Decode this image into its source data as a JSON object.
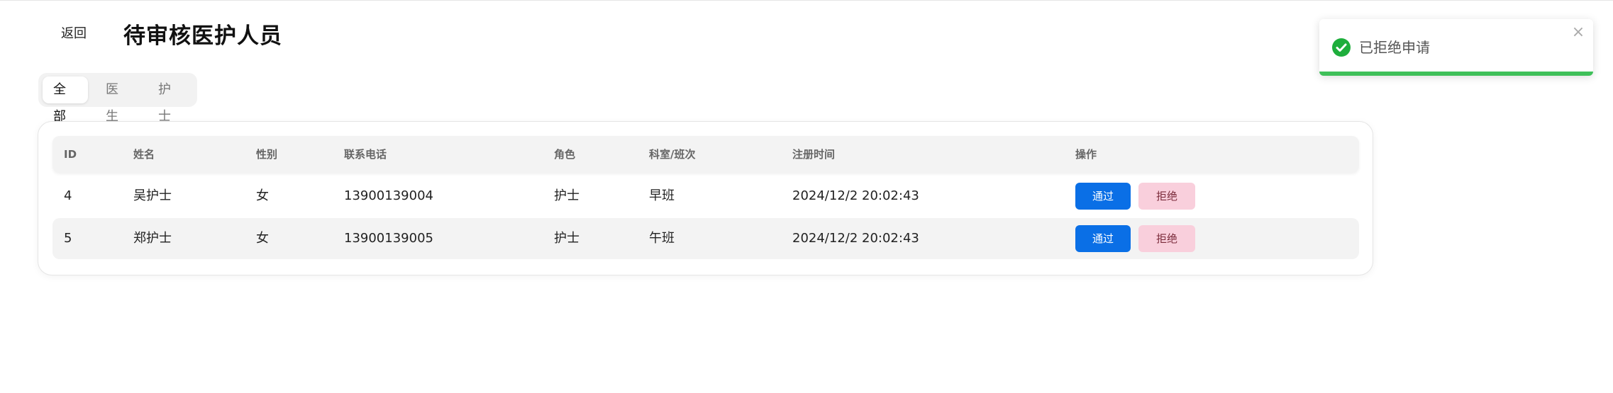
{
  "header": {
    "back_label": "返回",
    "title": "待审核医护人员"
  },
  "tabs": [
    {
      "label": "全部",
      "active": true
    },
    {
      "label": "医生",
      "active": false
    },
    {
      "label": "护士",
      "active": false
    }
  ],
  "table": {
    "columns": [
      "ID",
      "姓名",
      "性别",
      "联系电话",
      "角色",
      "科室/班次",
      "注册时间",
      "操作"
    ],
    "rows": [
      {
        "id": "4",
        "name": "吴护士",
        "gender": "女",
        "phone": "13900139004",
        "role": "护士",
        "dept": "早班",
        "time": "2024/12/2 20:02:43",
        "approve": "通过",
        "reject": "拒绝"
      },
      {
        "id": "5",
        "name": "郑护士",
        "gender": "女",
        "phone": "13900139005",
        "role": "护士",
        "dept": "午班",
        "time": "2024/12/2 20:02:43",
        "approve": "通过",
        "reject": "拒绝"
      }
    ]
  },
  "toast": {
    "message": "已拒绝申请",
    "icon": "check-circle-icon",
    "close_icon": "close-icon",
    "progress": 1.0,
    "color": "#1eae3c"
  },
  "colors": {
    "primary": "#0a6fe6",
    "reject_bg": "#f9cfdc",
    "success": "#1eae3c"
  }
}
